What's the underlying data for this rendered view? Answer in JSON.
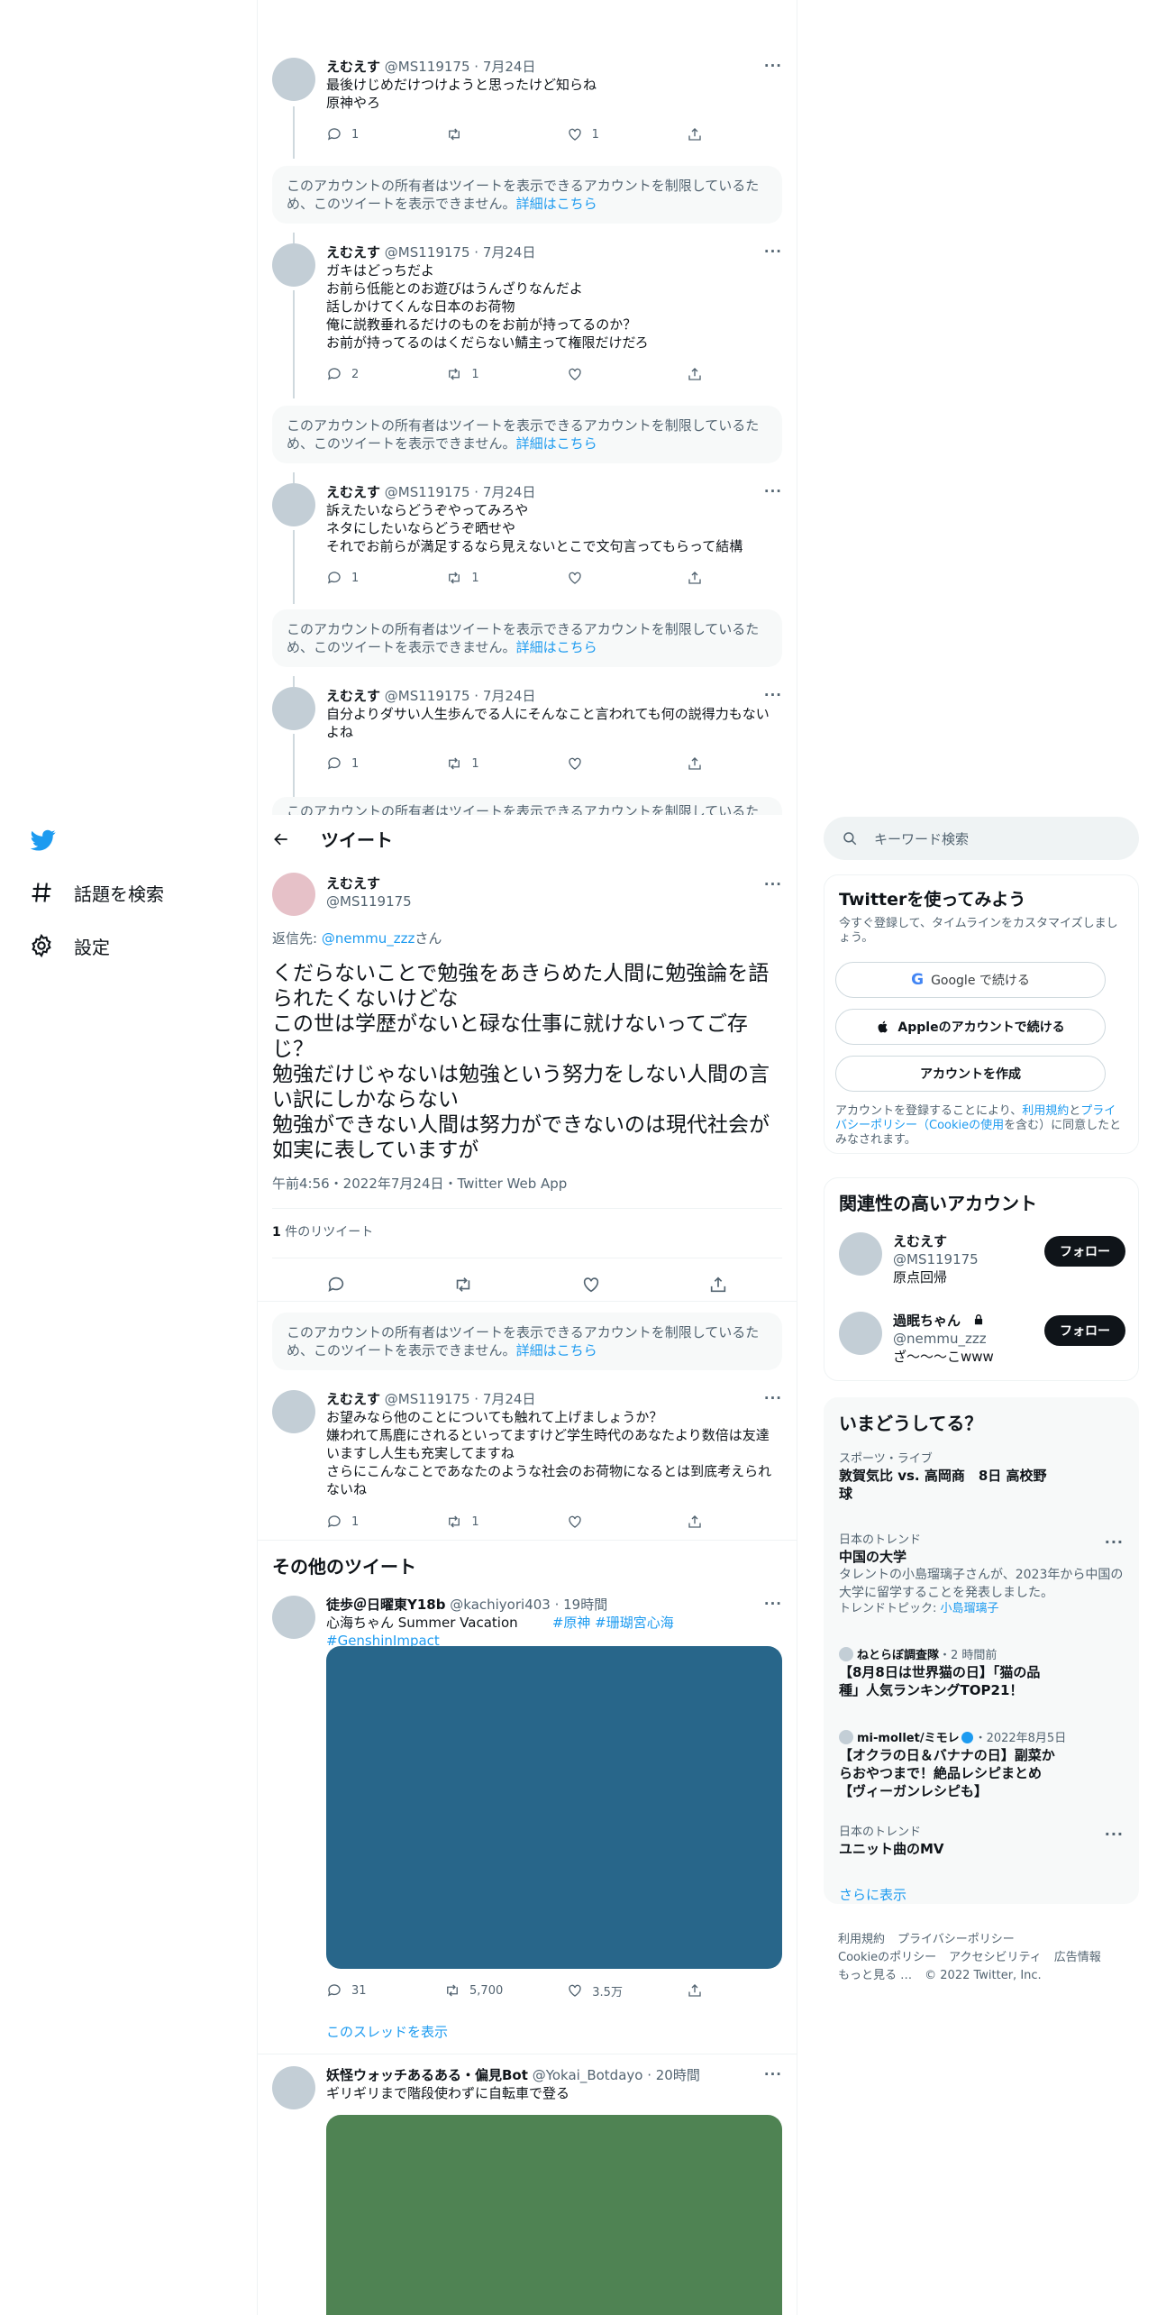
{
  "nav": {
    "explore_label": "話題を検索",
    "settings_label": "設定"
  },
  "header": {
    "title": "ツイート"
  },
  "notice": {
    "text": "このアカウントの所有者はツイートを表示できるアカウントを制限しているため、このツイートを表示できません。",
    "link": "詳細はこちら"
  },
  "thread": [
    {
      "name": "えむえす",
      "handle": "@MS119175",
      "time": "7月24日",
      "text": "最後けじめだけつけようと思ったけど知らね\n原神やろ",
      "reply": "1",
      "retweet": "",
      "like": "1"
    },
    {
      "name": "えむえす",
      "handle": "@MS119175",
      "time": "7月24日",
      "text": "ガキはどっちだよ\nお前ら低能とのお遊びはうんざりなんだよ\n話しかけてくんな日本のお荷物\n俺に説教垂れるだけのものをお前が持ってるのか？\nお前が持ってるのはくだらない鯖主って権限だけだろ",
      "reply": "2",
      "retweet": "1",
      "like": ""
    },
    {
      "name": "えむえす",
      "handle": "@MS119175",
      "time": "7月24日",
      "text": "訴えたいならどうぞやってみろや\nネタにしたいならどうぞ晒せや\nそれでお前らが満足するなら見えないとこで文句言ってもらって結構",
      "reply": "1",
      "retweet": "1",
      "like": ""
    },
    {
      "name": "えむえす",
      "handle": "@MS119175",
      "time": "7月24日",
      "text": "自分よりダサい人生歩んでる人にそんなこと言われても何の説得力もないよね",
      "reply": "1",
      "retweet": "1",
      "like": ""
    }
  ],
  "main_tweet": {
    "name": "えむえす",
    "handle": "@MS119175",
    "reply_to_prefix": "返信先: ",
    "reply_to": "@nemmu_zzz",
    "reply_to_suffix": "さん",
    "text": "くだらないことで勉強をあきらめた人間に勉強論を語られたくないけどな\nこの世は学歴がないと碌な仕事に就けないってご存じ？\n勉強だけじゃないは勉強という努力をしない人間の言い訳にしかならない\n勉強ができない人間は努力ができないのは現代社会が如実に表していますが",
    "timestamp": "午前4:56・2022年7月24日・Twitter Web App",
    "retweet_count": "1",
    "retweet_label": " 件のリツイート"
  },
  "reply_tweet": {
    "name": "えむえす",
    "handle": "@MS119175",
    "time": "7月24日",
    "text": "お望みなら他のことについても触れて上げましょうか？\n嫌われて馬鹿にされるといってますけど学生時代のあなたより数倍は友達いますし人生も充実してますね\nさらにこんなことであなたのような社会のお荷物になるとは到底考えられないね",
    "reply": "1",
    "retweet": "1",
    "like": ""
  },
  "more_tweets": {
    "title": "その他のツイート",
    "items": [
      {
        "name": "徒歩＠日曜東Y18b",
        "handle": "@kachiyori403",
        "time": "19時間",
        "text": "心海ちゃん Summer Vacation",
        "hashtags": "#原神 #珊瑚宮心海 #GenshinImpact",
        "media_color": "#28668a",
        "reply": "31",
        "retweet": "5,700",
        "like": "3.5万",
        "show_thread": "このスレッドを表示"
      },
      {
        "name": "妖怪ウォッチあるある・偏見Bot",
        "handle": "@Yokai_Botdayo",
        "time": "20時間",
        "text": "ギリギリまで階段使わずに自転車で登る",
        "media_color": "#4f8353"
      }
    ]
  },
  "search": {
    "placeholder": "キーワード検索"
  },
  "signup": {
    "title": "Twitterを使ってみよう",
    "sub": "今すぐ登録して、タイムラインをカスタマイズしましょう。",
    "google": "Google で続ける",
    "apple": "Appleのアカウントで続ける",
    "create": "アカウントを作成",
    "terms_prefix": "アカウントを登録することにより、",
    "terms_link1": "利用規約",
    "terms_mid1": "と",
    "terms_link2": "プライバシーポリシー（Cookieの使用",
    "terms_suffix": "を含む）に同意したとみなされます。"
  },
  "related": {
    "title": "関連性の高いアカウント",
    "follow_label": "フォロー",
    "accounts": [
      {
        "name": "えむえす",
        "handle": "@MS119175",
        "bio": "原点回帰"
      },
      {
        "name": "過眠ちゃん",
        "handle": "@nemmu_zzz",
        "bio": "ざ〜〜〜こwww"
      }
    ]
  },
  "trends": {
    "title": "いまどうしてる？",
    "items": [
      {
        "meta": "スポーツ・ライブ",
        "name": "敦賀気比 vs. 高岡商　8日 高校野球"
      },
      {
        "meta": "日本のトレンド",
        "name": "中国の大学",
        "desc": "タレントの小島瑠璃子さんが、2023年から中国の大学に留学することを発表しました。",
        "topic_prefix": "トレンドトピック: ",
        "topic": "小島瑠璃子"
      },
      {
        "meta_source": "ねとらぼ調査隊",
        "meta_time": "・2 時間前",
        "name": "【8月8日は世界猫の日】「猫の品種」人気ランキングTOP21！"
      },
      {
        "meta_source": "mi-mollet/ミモレ",
        "meta_time": "・2022年8月5日",
        "name": "【オクラの日＆バナナの日】副菜からおやつまで！絶品レシピまとめ【ヴィーガンレシピも】"
      },
      {
        "meta": "日本のトレンド",
        "name": "ユニット曲のMV"
      }
    ],
    "show_more": "さらに表示"
  },
  "footer": {
    "links": [
      "利用規約",
      "プライバシーポリシー",
      "Cookieのポリシー",
      "アクセシビリティ",
      "広告情報",
      "もっと見る …"
    ],
    "copyright": "© 2022 Twitter, Inc."
  },
  "colors": {
    "accent": "#1d9bf0",
    "text": "#0f1419",
    "muted": "#536471"
  }
}
